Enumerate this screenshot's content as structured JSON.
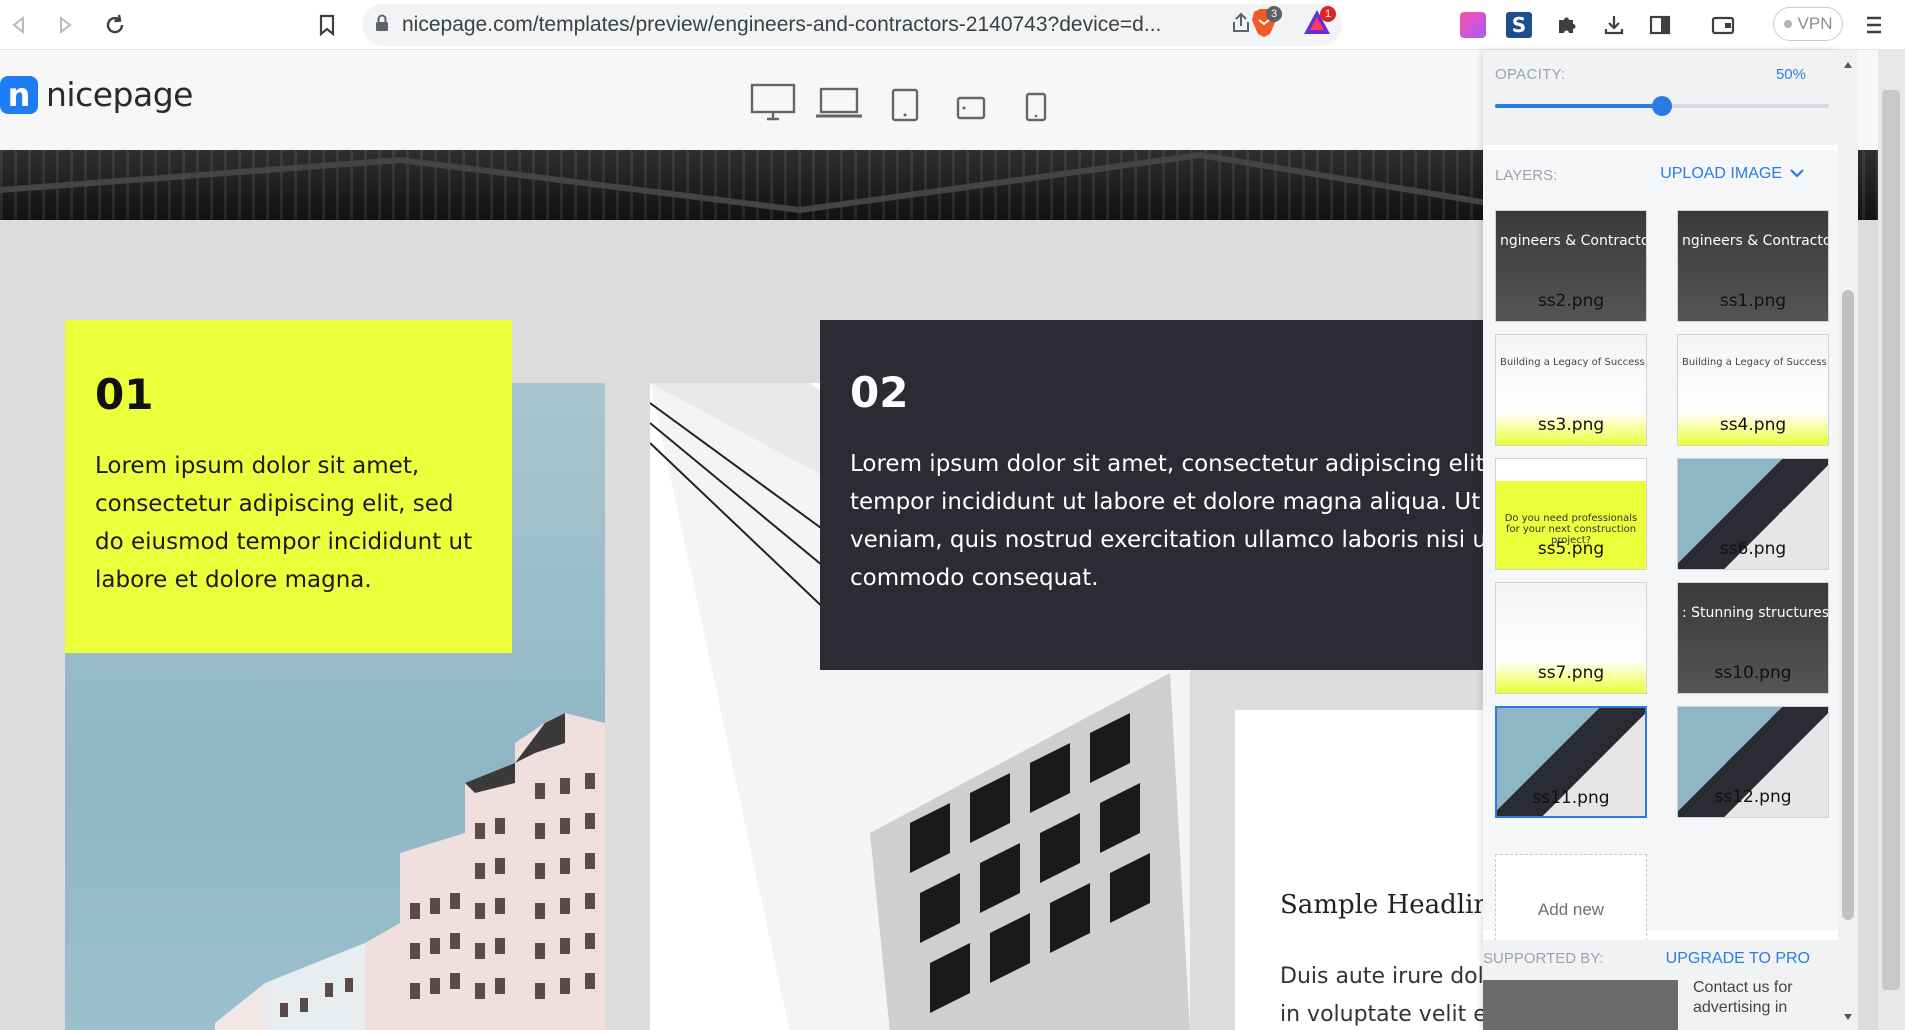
{
  "browser": {
    "url": "nicepage.com/templates/preview/engineers-and-contractors-2140743?device=d...",
    "brave_shields_count": "3",
    "rewards_count": "1",
    "vpn_label": "VPN"
  },
  "site": {
    "logo_text": "nicepage",
    "devices": [
      "desktop-icon",
      "laptop-icon",
      "tablet-icon",
      "tablet-landscape-icon",
      "phone-icon"
    ]
  },
  "content": {
    "card1": {
      "number": "01",
      "text": "Lorem ipsum dolor sit amet, consectetur adipiscing elit, sed do eiusmod tempor incididunt ut labore et dolore magna."
    },
    "card2": {
      "number": "02",
      "text_lines": [
        "Lorem ipsum dolor sit amet, consectetur adipiscing elit, s",
        "tempor incididunt ut labore et dolore magna aliqua. Ut en",
        "veniam, quis nostrud exercitation ullamco laboris nisi ut a",
        "commodo consequat."
      ]
    },
    "sample_headline": "Sample Headline",
    "sample_text_lines": [
      "Duis aute irure dol",
      "in voluptate velit e"
    ]
  },
  "panel": {
    "opacity_label": "OPACITY:",
    "opacity_value": "50%",
    "opacity_fraction": 0.5,
    "layers_label": "LAYERS:",
    "upload_label": "UPLOAD IMAGE",
    "layers": [
      {
        "name": "ss2.png",
        "caption": "ngineers & Contractor",
        "style": "dark"
      },
      {
        "name": "ss1.png",
        "caption": "ngineers & Contractor",
        "style": "dark"
      },
      {
        "name": "ss3.png",
        "caption": "Building a Legacy of Success",
        "style": "light"
      },
      {
        "name": "ss4.png",
        "caption": "Building a Legacy of Success",
        "style": "light"
      },
      {
        "name": "ss5.png",
        "caption": "Do you need professionals for your next construction project?",
        "style": "yellow"
      },
      {
        "name": "ss6.png",
        "caption": "",
        "style": "photo"
      },
      {
        "name": "ss7.png",
        "caption": "",
        "style": "light"
      },
      {
        "name": "ss10.png",
        "caption": ": Stunning structures, sustainably built",
        "style": "dark"
      },
      {
        "name": "ss11.png",
        "caption": "",
        "style": "photo",
        "active": true
      },
      {
        "name": "ss12.png",
        "caption": "",
        "style": "photo"
      }
    ],
    "add_new_label": "Add new",
    "supported_by_label": "SUPPORTED BY:",
    "upgrade_label": "UPGRADE TO PRO",
    "contact_label": "Contact us for advertising in"
  },
  "colors": {
    "accent_blue": "#2c7be5",
    "yellow": "#ebff3a",
    "dark_card": "#2a2b33"
  }
}
